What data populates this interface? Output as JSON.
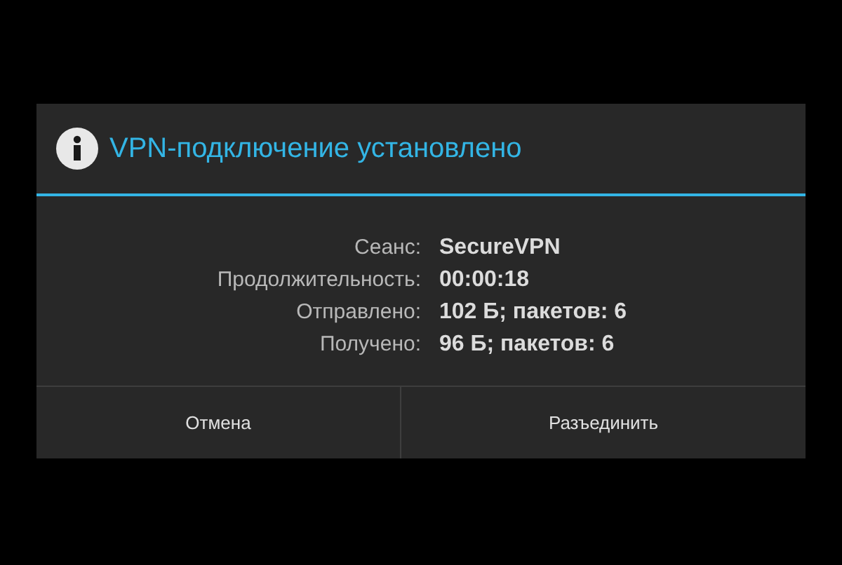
{
  "dialog": {
    "title": "VPN-подключение установлено",
    "fields": [
      {
        "label": "Сеанс:",
        "value": "SecureVPN"
      },
      {
        "label": "Продолжительность:",
        "value": "00:00:18"
      },
      {
        "label": "Отправлено:",
        "value": "102 Б; пакетов: 6"
      },
      {
        "label": "Получено:",
        "value": "96 Б; пакетов: 6"
      }
    ],
    "buttons": [
      "Отмена",
      "Разъединить"
    ]
  }
}
